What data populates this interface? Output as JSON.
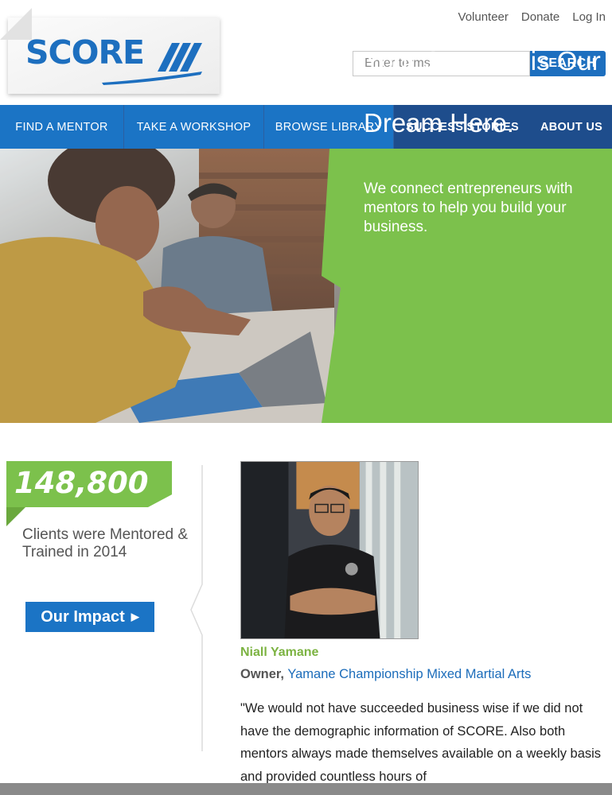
{
  "header": {
    "logo_text": "SCORE",
    "util_nav": [
      "Volunteer",
      "Donate",
      "Log In"
    ],
    "search_placeholder": "Enter terms",
    "search_button": "SEARCH"
  },
  "nav": {
    "items": [
      "FIND A MENTOR",
      "TAKE A WORKSHOP",
      "BROWSE LIBRARY",
      "SUCCESS STORIES",
      "ABOUT US"
    ]
  },
  "hero": {
    "headline": "Your Success is Our Success. Build Your Dream Here.",
    "subtext": "We connect entrepreneurs with mentors to help you build your business."
  },
  "stats": {
    "number": "148,800",
    "caption": "Clients were Mentored & Trained in 2014",
    "button": "Our Impact",
    "button_icon": "caret-right-icon"
  },
  "testimonial": {
    "name": "Niall Yamane",
    "role": "Owner,",
    "company": "Yamane Championship Mixed Martial Arts",
    "quote": "\"We would not have succeeded business wise if we did not have the demographic information of SCORE. Also both mentors always made themselves available on a weekly basis and provided countless hours of"
  },
  "colors": {
    "brand_blue": "#1d6fbf",
    "nav_dark": "#1e4d8c",
    "accent_green": "#7cc14c"
  }
}
